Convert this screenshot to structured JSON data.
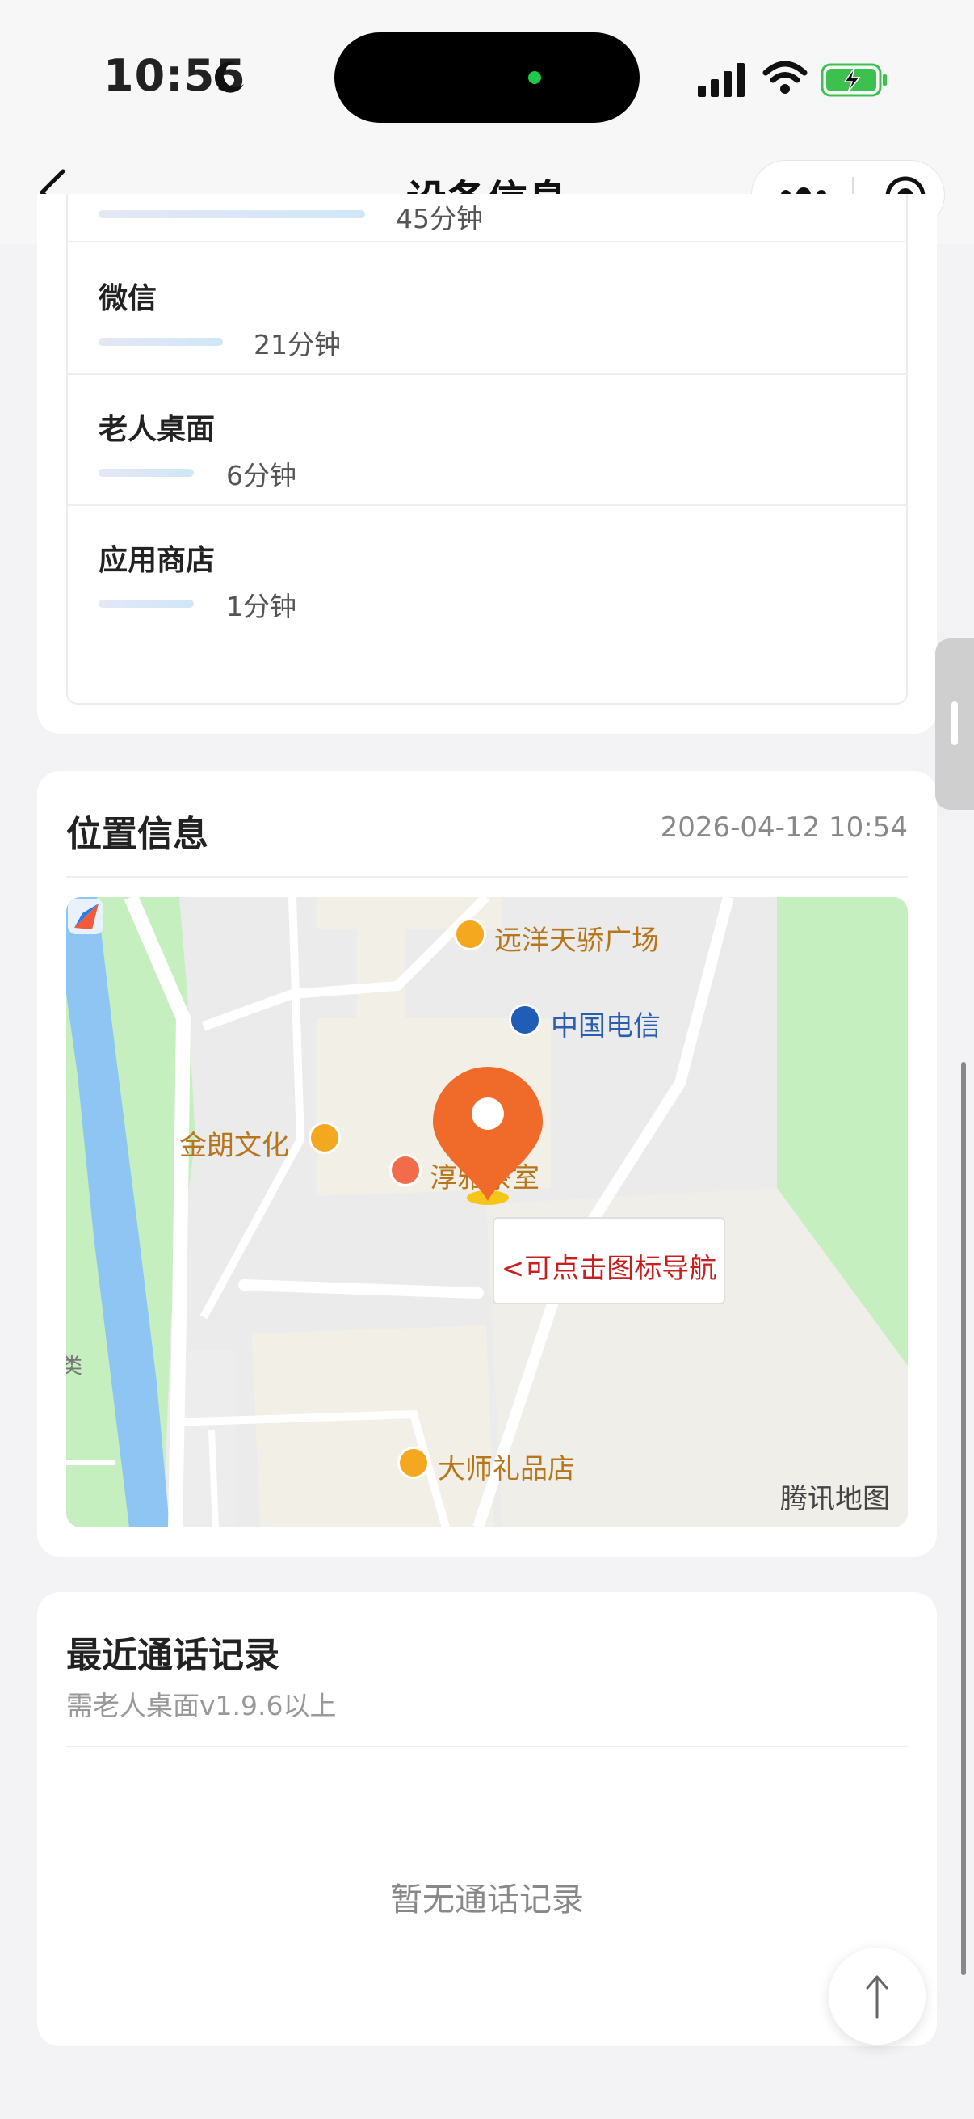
{
  "status_bar": {
    "time": "10:55"
  },
  "nav": {
    "title": "设备信息"
  },
  "app_usage": [
    {
      "name": "",
      "duration": "45分钟",
      "share": 0.46
    },
    {
      "name": "微信",
      "duration": "21分钟",
      "share": 0.21
    },
    {
      "name": "老人桌面",
      "duration": "6分钟",
      "share": 0.09
    },
    {
      "name": "应用商店",
      "duration": "1分钟",
      "share": 0.09
    }
  ],
  "location": {
    "title": "位置信息",
    "timestamp": "2026-04-12 10:54",
    "map": {
      "pois": {
        "plaza": "远洋天骄广场",
        "telecom": "中国电信",
        "culture": "金朗文化",
        "tearoom": "淳雅茶室",
        "gift_shop": "大师礼品店"
      },
      "edge_label": "类",
      "nav_tip": "<可点击图标导航",
      "provider": "腾讯地图"
    }
  },
  "calls": {
    "title": "最近通话记录",
    "subtitle": "需老人桌面v1.9.6以上",
    "empty": "暂无通话记录"
  },
  "colors": {
    "marker": "#f06a2a",
    "nav_tip_text": "#c81e1e",
    "poi_text": "#b7761c"
  }
}
